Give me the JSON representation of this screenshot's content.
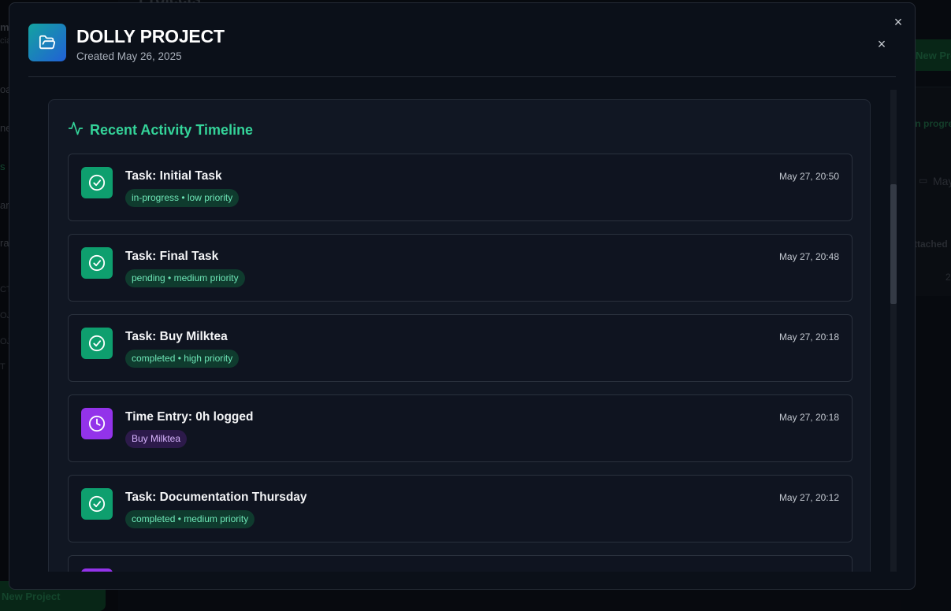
{
  "background": {
    "page_title": "Projects",
    "sidebar_fragments": [
      "m",
      "cia",
      "oa",
      "ne",
      "s",
      "ar",
      "ra",
      "CT",
      "OJ",
      "OJ",
      "T"
    ],
    "new_project_label": "New Project",
    "right_fragments": {
      "new_button": "New Proje",
      "status": "in progre",
      "date": "May",
      "attached": "ttached",
      "number": "2"
    }
  },
  "modal": {
    "close_outer": "×",
    "project_name": "DOLLY PROJECT",
    "created": "Created May 26, 2025",
    "close_inner": "×",
    "timeline": {
      "title": "Recent Activity Timeline",
      "items": [
        {
          "kind": "task",
          "title": "Task: Initial Task",
          "time": "May 27, 20:50",
          "tag": "in-progress • low priority"
        },
        {
          "kind": "task",
          "title": "Task: Final Task",
          "time": "May 27, 20:48",
          "tag": "pending • medium priority"
        },
        {
          "kind": "task",
          "title": "Task: Buy Milktea",
          "time": "May 27, 20:18",
          "tag": "completed • high priority"
        },
        {
          "kind": "time",
          "title": "Time Entry: 0h logged",
          "time": "May 27, 20:18",
          "tag": "Buy Milktea"
        },
        {
          "kind": "task",
          "title": "Task: Documentation Thursday",
          "time": "May 27, 20:12",
          "tag": "completed • medium priority"
        },
        {
          "kind": "time",
          "title": "",
          "time": "",
          "tag": ""
        }
      ]
    }
  },
  "colors": {
    "accent_green": "#34d399",
    "task_icon": "#0e9f6e",
    "time_icon": "#9333ea"
  },
  "icons": {
    "project": "folder-open-icon",
    "timeline": "activity-pulse-icon",
    "task": "check-circle-icon",
    "time": "clock-icon",
    "close": "close-icon"
  }
}
